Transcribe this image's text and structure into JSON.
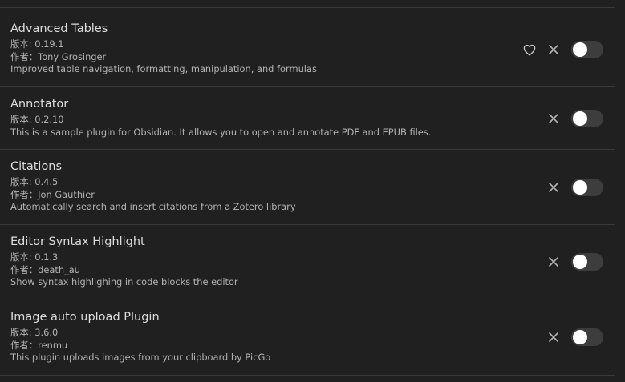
{
  "plugins": [
    {
      "name": "Advanced Tables",
      "version_line": "版本: 0.19.1",
      "author_line": "作者：Tony Grosinger",
      "description": "Improved table navigation, formatting, manipulation, and formulas",
      "has_donate": true,
      "enabled": false
    },
    {
      "name": "Annotator",
      "version_line": "版本: 0.2.10",
      "description": "This is a sample plugin for Obsidian. It allows you to open and annotate PDF and EPUB files.",
      "has_donate": false,
      "enabled": false
    },
    {
      "name": "Citations",
      "version_line": "版本: 0.4.5",
      "author_line": "作者：Jon Gauthier",
      "description": "Automatically search and insert citations from a Zotero library",
      "has_donate": false,
      "enabled": false
    },
    {
      "name": "Editor Syntax Highlight",
      "version_line": "版本: 0.1.3",
      "author_line": "作者：death_au",
      "description": "Show syntax highlighing in code blocks the editor",
      "has_donate": false,
      "enabled": false
    },
    {
      "name": "Image auto upload Plugin",
      "version_line": "版本: 3.6.0",
      "author_line": "作者：renmu",
      "description": "This plugin uploads images from your clipboard by PicGo",
      "has_donate": false,
      "enabled": false
    }
  ],
  "icons": {
    "donate": "heart-icon",
    "uninstall": "close-icon"
  },
  "colors": {
    "background": "#202020",
    "divider": "#3a3a3a",
    "toggle_off": "#3d3d3d",
    "icon": "#b3b3b3"
  }
}
